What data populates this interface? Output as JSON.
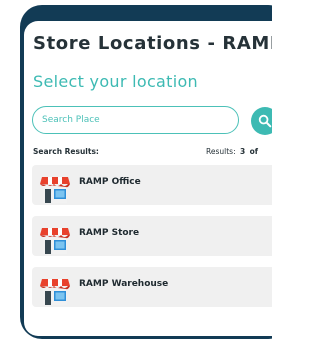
{
  "header": {
    "title": "Store Locations - RAMP",
    "subtitle": "Select your location"
  },
  "search": {
    "placeholder": "Search Place",
    "value": ""
  },
  "results": {
    "label": "Search Results:",
    "count_prefix": "Results:",
    "count": "3",
    "count_suffix": "of"
  },
  "locations": [
    {
      "name": "RAMP Office"
    },
    {
      "name": "RAMP Store"
    },
    {
      "name": "RAMP Warehouse"
    }
  ],
  "colors": {
    "frame": "#123b55",
    "accent": "#3dbab3",
    "awning_red": "#e8412c",
    "window_blue": "#2f8fd8",
    "item_bg": "#f0f0f0"
  },
  "icons": {
    "search_button": "search-icon",
    "location_item": "store-icon"
  }
}
